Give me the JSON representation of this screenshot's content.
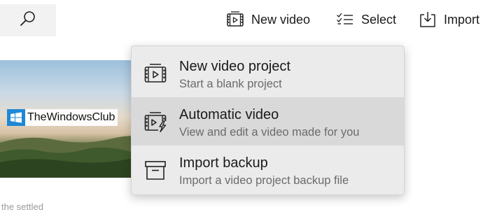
{
  "toolbar": {
    "search_icon": "search-icon",
    "new_video": {
      "label": "New video",
      "icon": "film-icon"
    },
    "select": {
      "label": "Select",
      "icon": "checklist-icon"
    },
    "import": {
      "label": "Import",
      "icon": "import-icon"
    }
  },
  "thumbnail": {
    "watermark_text": "TheWindowsClub"
  },
  "caption_peek": "the settled",
  "menu": {
    "items": [
      {
        "title": "New video project",
        "subtitle": "Start a blank project",
        "icon": "film-icon"
      },
      {
        "title": "Automatic video",
        "subtitle": "View and edit a video made for you",
        "icon": "film-lightning-icon"
      },
      {
        "title": "Import backup",
        "subtitle": "Import a video project backup file",
        "icon": "archive-icon"
      }
    ]
  },
  "colors": {
    "menu_background": "#ebebeb",
    "menu_hover": "#d9d9d9",
    "search_background": "#f2f2f2",
    "watermark_logo": "#1e88d6"
  }
}
